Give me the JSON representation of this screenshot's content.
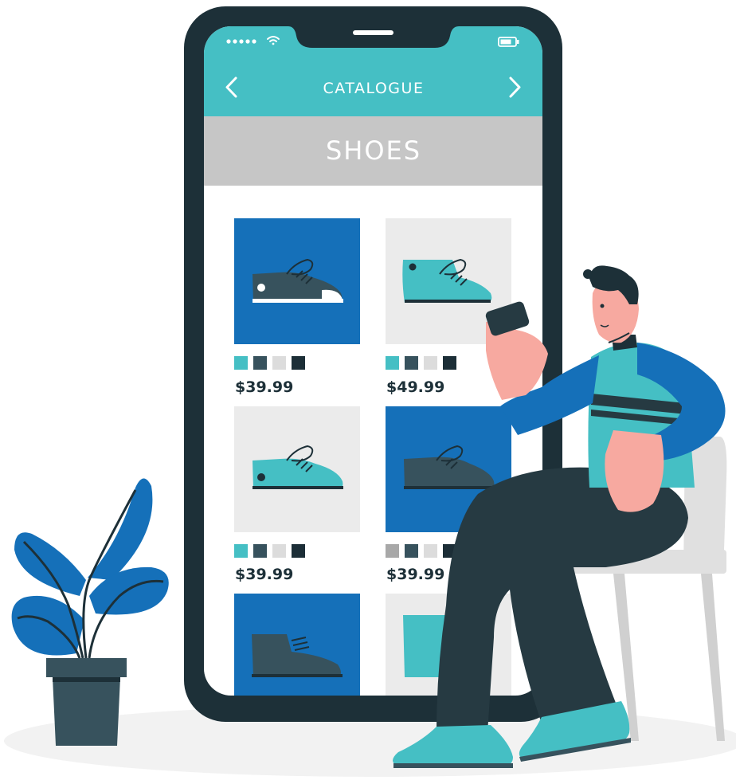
{
  "header": {
    "title": "CATALOGUE",
    "prev_icon": "chevron-left-icon",
    "next_icon": "chevron-right-icon"
  },
  "status_bar": {
    "signal_icon": "signal-dots-icon",
    "wifi_icon": "wifi-icon",
    "battery_icon": "battery-icon"
  },
  "category": {
    "title": "SHOES"
  },
  "products": [
    {
      "price": "$39.99",
      "swatches": [
        "#45bfc4",
        "#37525d",
        "#dcdcdc",
        "#1c2e37"
      ]
    },
    {
      "price": "$49.99",
      "swatches": [
        "#45bfc4",
        "#37525d",
        "#dcdcdc",
        "#1c2e37"
      ]
    },
    {
      "price": "$39.99",
      "swatches": [
        "#45bfc4",
        "#37525d",
        "#dcdcdc",
        "#1c2e37"
      ]
    },
    {
      "price": "$39.99",
      "swatches": [
        "#a8a8a8",
        "#37525d",
        "#dcdcdc",
        "#1c2e37"
      ]
    }
  ],
  "colors": {
    "accent": "#45bfc4",
    "brand_blue": "#1570b9",
    "phone_frame": "#1d3038",
    "category_bar": "#c6c6c6",
    "dark": "#263a42"
  }
}
